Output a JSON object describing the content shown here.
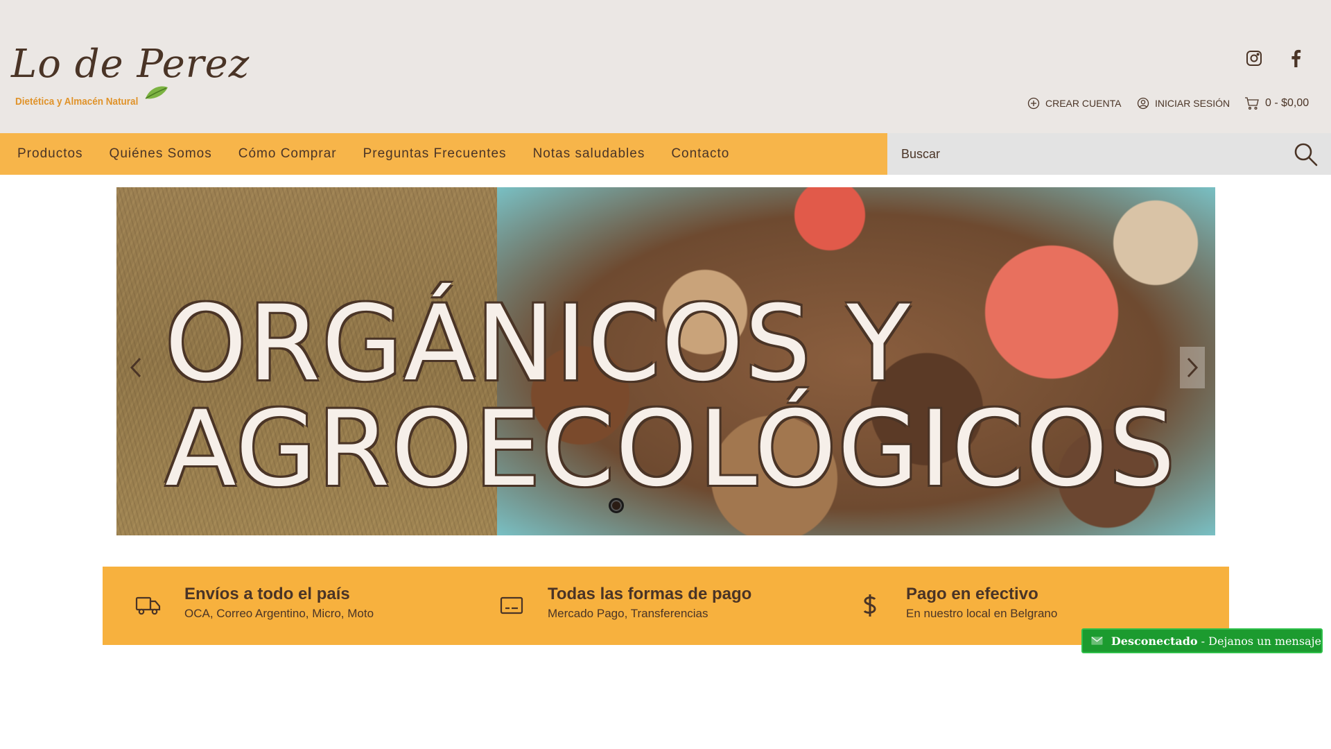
{
  "brand": {
    "logo_script": "Lo de Perez",
    "logo_tagline": "Dietética y Almacén Natural"
  },
  "social": {
    "instagram_icon": "instagram-icon",
    "facebook_icon": "facebook-icon"
  },
  "account": {
    "create_label": "CREAR CUENTA",
    "login_label": "INICIAR SESIÓN",
    "cart_label": "0 - $0,00"
  },
  "nav": {
    "items": [
      {
        "label": "Productos"
      },
      {
        "label": "Quiénes Somos"
      },
      {
        "label": "Cómo Comprar"
      },
      {
        "label": "Preguntas Frecuentes"
      },
      {
        "label": "Notas saludables"
      },
      {
        "label": "Contacto"
      }
    ]
  },
  "search": {
    "placeholder": "Buscar"
  },
  "slider": {
    "line1": "ORGÁNICOS Y",
    "line2": "AGROECOLÓGICOS",
    "active_slide": 1,
    "slide_count": 1
  },
  "features": [
    {
      "icon": "truck-icon",
      "title": "Envíos a todo el país",
      "subtitle": "OCA, Correo Argentino, Micro, Moto"
    },
    {
      "icon": "card-icon",
      "title": "Todas las formas de pago",
      "subtitle": "Mercado Pago, Transferencias"
    },
    {
      "icon": "dollar-icon",
      "title": "Pago en efectivo",
      "subtitle": "En nuestro local en Belgrano"
    }
  ],
  "chat": {
    "status": "Desconectado",
    "message": " - Dejanos un mensaje"
  },
  "colors": {
    "header_bg": "#ebe7e4",
    "accent": "#f7b54a",
    "brown": "#4a3426",
    "chat_green": "#1c9b2f"
  }
}
